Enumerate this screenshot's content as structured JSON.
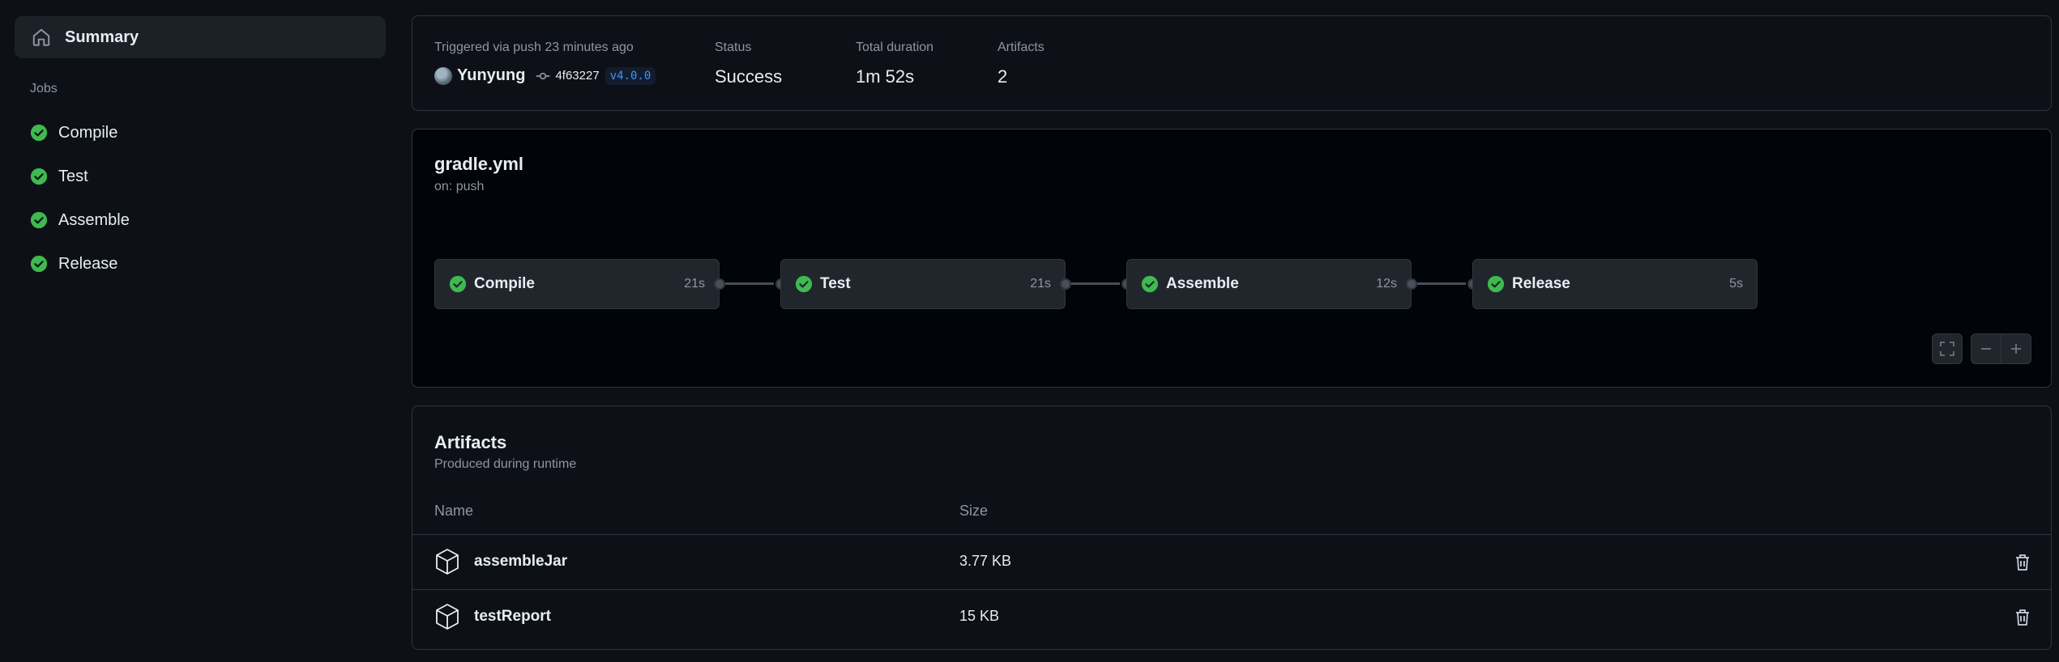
{
  "sidebar": {
    "summary_label": "Summary",
    "jobs_heading": "Jobs",
    "jobs": [
      {
        "label": "Compile"
      },
      {
        "label": "Test"
      },
      {
        "label": "Assemble"
      },
      {
        "label": "Release"
      }
    ]
  },
  "run_info": {
    "trigger_text": "Triggered via push 23 minutes ago",
    "actor": "Yunyung",
    "commit_sha": "4f63227",
    "tag": "v4.0.0",
    "status_label": "Status",
    "status_value": "Success",
    "duration_label": "Total duration",
    "duration_value": "1m 52s",
    "artifacts_label": "Artifacts",
    "artifacts_value": "2"
  },
  "workflow": {
    "file": "gradle.yml",
    "trigger": "on: push",
    "jobs": [
      {
        "name": "Compile",
        "duration": "21s"
      },
      {
        "name": "Test",
        "duration": "21s"
      },
      {
        "name": "Assemble",
        "duration": "12s"
      },
      {
        "name": "Release",
        "duration": "5s"
      }
    ]
  },
  "artifacts": {
    "title": "Artifacts",
    "subtitle": "Produced during runtime",
    "columns": {
      "name": "Name",
      "size": "Size"
    },
    "rows": [
      {
        "name": "assembleJar",
        "size": "3.77 KB"
      },
      {
        "name": "testReport",
        "size": "15 KB"
      }
    ]
  },
  "colors": {
    "background": "#0d1117",
    "success": "#3fb950",
    "link": "#4493f8",
    "border": "#30363d"
  },
  "icons": {
    "summary": "home-icon",
    "job_status": "check-circle-icon",
    "commit": "git-commit-icon",
    "artifact": "package-icon",
    "delete": "trash-icon",
    "fullscreen": "fullscreen-icon",
    "zoom_out": "minus-icon",
    "zoom_in": "plus-icon"
  }
}
